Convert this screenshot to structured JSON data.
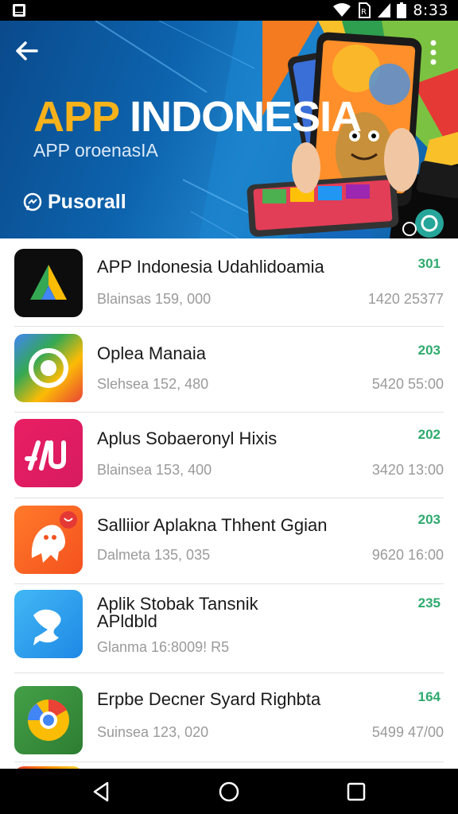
{
  "status_bar": {
    "time": "8:33"
  },
  "hero": {
    "title_part1": "APP",
    "title_part2": "INDONESIA",
    "subtitle": "APP oroenasIA",
    "brand": "Pusorall"
  },
  "apps": [
    {
      "title": "APP Indonesia Udahlidoamia",
      "title_line2": "",
      "subtitle": "Blainsas 159, 000",
      "number": "301",
      "meta": "1420  25377",
      "icon": "arrow-triangle-icon"
    },
    {
      "title": "Oplea Manaia",
      "title_line2": "",
      "subtitle": "Slehsea 152, 480",
      "number": "203",
      "meta": "5420  55:00",
      "icon": "target-ring-icon"
    },
    {
      "title": "Aplus Sobaeronyl Hixis",
      "title_line2": "",
      "subtitle": "Blainsea 153, 400",
      "number": "202",
      "meta": "3420  13:00",
      "icon": "slash-letters-icon"
    },
    {
      "title": "Salliior Aplakna Thhent Ggian",
      "title_line2": "",
      "subtitle": "Dalmeta 135, 035",
      "number": "203",
      "meta": "9620  16:00",
      "icon": "ghost-character-icon"
    },
    {
      "title": "Aplik Stobak Tansnik",
      "title_line2": "APldbld",
      "subtitle": "Glanma 16:8009! R5",
      "number": "235",
      "meta": "",
      "icon": "chat-swirl-icon"
    },
    {
      "title": "Erpbe Decner Syard Righbta",
      "title_line2": "",
      "subtitle": "Suinsea 123, 020",
      "number": "164",
      "meta": "5499  47/00",
      "icon": "chrome-swirl-icon"
    }
  ],
  "colors": {
    "accent_green": "#2eaa6e",
    "hero_blue": "#0d63ad",
    "title_yellow": "#f5b21a"
  }
}
